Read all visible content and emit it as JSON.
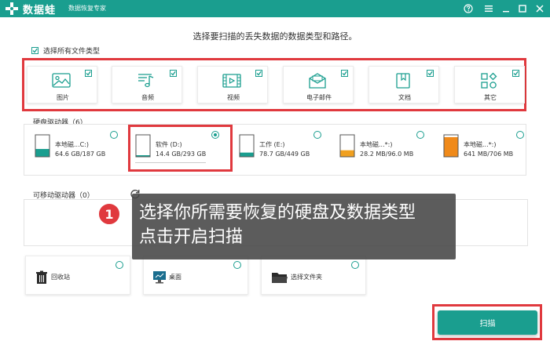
{
  "app": {
    "name": "数据蛙",
    "subtitle": "数据恢复专家"
  },
  "titlebar_controls": [
    "help-icon",
    "menu-icon",
    "minimize-icon",
    "maximize-icon",
    "close-icon"
  ],
  "heading": "选择要扫描的丢失数据的数据类型和路径。",
  "select_all": {
    "label": "选择所有文件类型",
    "checked": true
  },
  "file_types": [
    {
      "label": "图片",
      "icon": "image-icon",
      "checked": true
    },
    {
      "label": "音频",
      "icon": "music-icon",
      "checked": true
    },
    {
      "label": "视频",
      "icon": "video-icon",
      "checked": true
    },
    {
      "label": "电子邮件",
      "icon": "email-icon",
      "checked": true
    },
    {
      "label": "文档",
      "icon": "document-icon",
      "checked": true
    },
    {
      "label": "其它",
      "icon": "other-icon",
      "checked": true
    }
  ],
  "hdd_section": {
    "label": "硬盘驱动器（6）"
  },
  "drives": [
    {
      "name": "本地磁...C:)",
      "size": "64.6 GB/187 GB",
      "selected": false,
      "fill": 0.35,
      "color": "#1a9e8f"
    },
    {
      "name": "软件 (D:)",
      "size": "14.4 GB/293 GB",
      "selected": true,
      "fill": 0.05,
      "color": "#1a9e8f"
    },
    {
      "name": "工作 (E:)",
      "size": "78.7 GB/449 GB",
      "selected": false,
      "fill": 0.18,
      "color": "#1a9e8f"
    },
    {
      "name": "本地磁...*:)",
      "size": "28.2 MB/96.0 MB",
      "selected": false,
      "fill": 0.29,
      "color": "#f0a020"
    },
    {
      "name": "本地磁...*:)",
      "size": "641 MB/706 MB",
      "selected": false,
      "fill": 0.91,
      "color": "#f08a1a"
    }
  ],
  "removable_section": {
    "label": "可移动驱动器（0）"
  },
  "locations": [
    {
      "label": "回收站",
      "icon": "recycle-bin-icon"
    },
    {
      "label": "桌面",
      "icon": "desktop-icon"
    },
    {
      "label": "选择文件夹",
      "icon": "folder-icon"
    }
  ],
  "tooltip": {
    "step": "1",
    "line1": "选择你所需要恢复的硬盘及数据类型",
    "line2": "点击开启扫描"
  },
  "scan_button": {
    "label": "扫描"
  },
  "colors": {
    "accent": "#1a9e8f",
    "highlight": "#e0393e"
  }
}
